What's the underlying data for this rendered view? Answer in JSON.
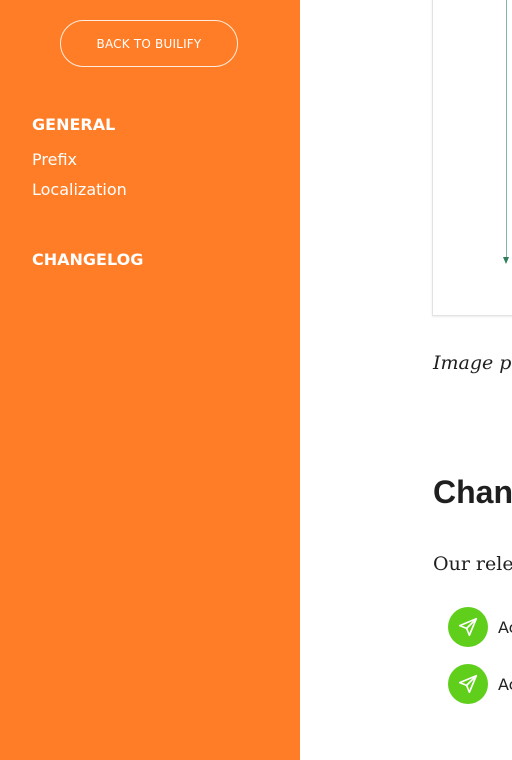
{
  "sidebar": {
    "back_button_label": "BACK TO BUILIFY",
    "sections": [
      {
        "heading": "GENERAL",
        "items": [
          "Prefix",
          "Localization"
        ]
      },
      {
        "heading": "CHANGELOG",
        "items": []
      }
    ]
  },
  "main": {
    "image_caption": "Image pro",
    "changelog_title": "Chan",
    "changelog_intro": "Our relea",
    "release_items": [
      {
        "icon": "paper-plane-icon",
        "label": "Ac"
      },
      {
        "icon": "paper-plane-icon",
        "label": "Ac"
      }
    ]
  },
  "colors": {
    "sidebar_bg": "#ff7d26",
    "release_icon_bg": "#5fcf1c",
    "diagram_line": "#2e7d5b"
  }
}
